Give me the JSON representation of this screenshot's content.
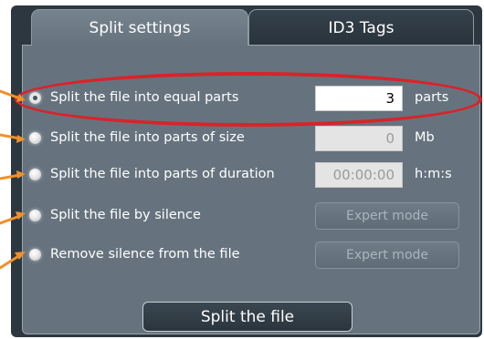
{
  "tabs": [
    {
      "label": "Split settings",
      "active": true
    },
    {
      "label": "ID3 Tags",
      "active": false
    }
  ],
  "options": [
    {
      "label": "Split the file into equal parts",
      "selected": true,
      "value": "3",
      "unit": "parts"
    },
    {
      "label": "Split the file into parts of size",
      "selected": false,
      "value": "0",
      "unit": "Mb"
    },
    {
      "label": "Split the file into parts of duration",
      "selected": false,
      "value": "00:00:00",
      "unit": "h:m:s"
    },
    {
      "label": "Split the file by silence",
      "selected": false,
      "button": "Expert mode"
    },
    {
      "label": "Remove silence from the file",
      "selected": false,
      "button": "Expert mode"
    }
  ],
  "split_button": "Split the file",
  "colors": {
    "panel": "#66737e",
    "frame": "#2c3740",
    "highlight": "#d9232a",
    "arrow": "#f0902a"
  }
}
